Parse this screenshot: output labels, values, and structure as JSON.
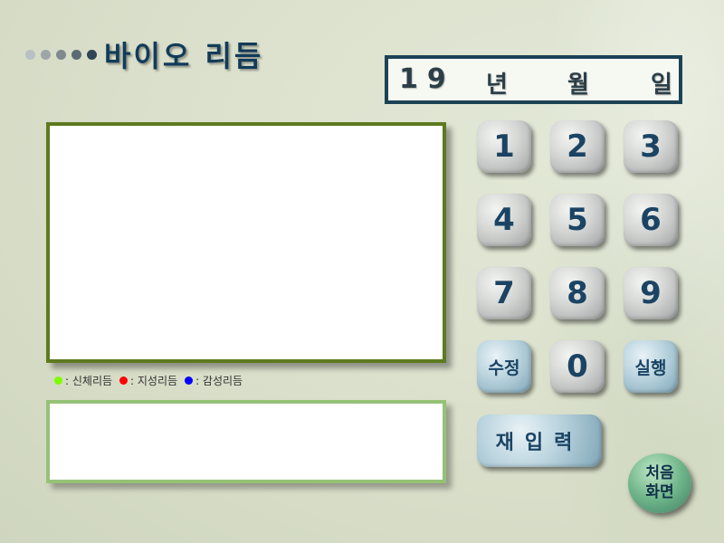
{
  "title": {
    "text": "바이오 리듬",
    "dot_colors": [
      "#b9c0c3",
      "#9ea6aa",
      "#7f898f",
      "#5b6a73",
      "#2f4656"
    ]
  },
  "date_input": {
    "year_prefix": "19",
    "units": [
      "년",
      "월",
      "일"
    ]
  },
  "legend": {
    "items": [
      {
        "label": ": 신체리듬",
        "color": "#7cfc00"
      },
      {
        "label": ": 지성리듬",
        "color": "#ff0000"
      },
      {
        "label": ": 감성리듬",
        "color": "#0000ff"
      }
    ]
  },
  "keypad": {
    "digits": [
      "1",
      "2",
      "3",
      "4",
      "5",
      "6",
      "7",
      "8",
      "9"
    ],
    "zero": "0",
    "edit_label": "수정",
    "run_label": "실행",
    "reenter_label": "재입력"
  },
  "home_button": {
    "line1": "처음",
    "line2": "화면"
  },
  "colors": {
    "chart_border": "#5d7a1f",
    "info_border": "#96c276",
    "date_border": "#1c4256",
    "key_text": "#1b4464"
  }
}
